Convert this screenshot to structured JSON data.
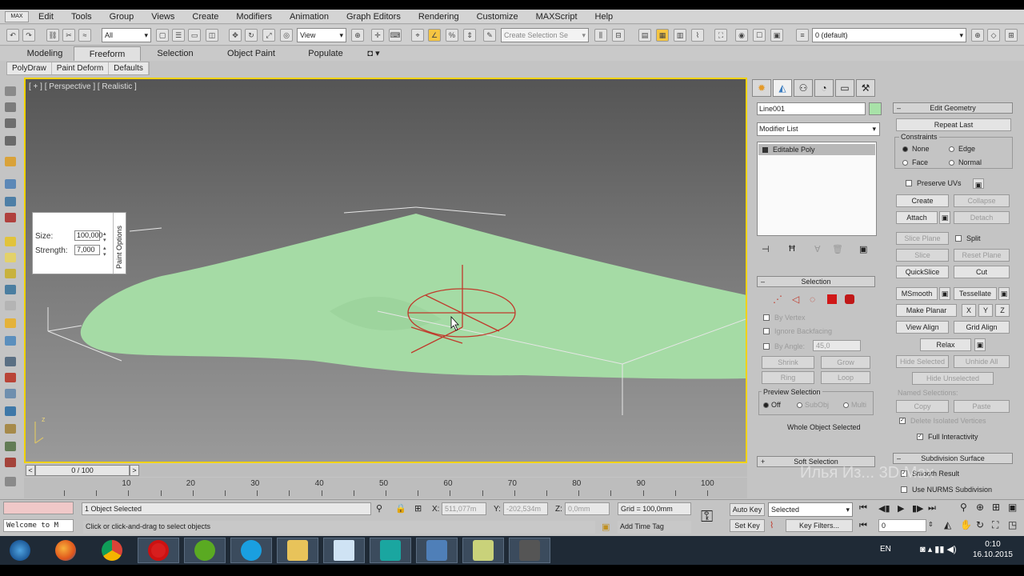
{
  "menu": [
    "Edit",
    "Tools",
    "Group",
    "Views",
    "Create",
    "Modifiers",
    "Animation",
    "Graph Editors",
    "Rendering",
    "Customize",
    "MAXScript",
    "Help"
  ],
  "logo_text": "MAX",
  "toolbar": {
    "filter_select": "All",
    "refcoord_select": "View",
    "selection_set_placeholder": "Create Selection Se",
    "layer_select": "0 (default)"
  },
  "ribbon": {
    "tabs": [
      "Modeling",
      "Freeform",
      "Selection",
      "Object Paint",
      "Populate"
    ],
    "active_tab": "Freeform",
    "sub_items": [
      "PolyDraw",
      "Paint Deform",
      "Defaults"
    ]
  },
  "viewport": {
    "label": "[ + ] [ Perspective ] [ Realistic ]",
    "axis_label": "z",
    "paint_options": {
      "title": "Paint Options",
      "size_label": "Size:",
      "size_value": "100,000",
      "strength_label": "Strength:",
      "strength_value": "7,000"
    }
  },
  "timeline": {
    "frame_display": "0 / 100",
    "prev_label": "<",
    "next_label": ">",
    "ticks": [
      10,
      20,
      30,
      40,
      50,
      60,
      70,
      80,
      90,
      100
    ]
  },
  "command_panel": {
    "object_name": "Line001",
    "modifier_list": "Modifier List",
    "stack_item": "Editable Poly",
    "selection": {
      "header": "Selection",
      "by_vertex": "By Vertex",
      "ignore_backfacing": "Ignore Backfacing",
      "by_angle": "By Angle:",
      "angle_value": "45,0",
      "shrink": "Shrink",
      "grow": "Grow",
      "ring": "Ring",
      "loop": "Loop",
      "preview_group": "Preview Selection",
      "preview_off": "Off",
      "preview_subobj": "SubObj",
      "preview_multi": "Multi",
      "status": "Whole Object Selected"
    },
    "soft_selection_header": "Soft Selection"
  },
  "edit_geometry": {
    "header": "Edit Geometry",
    "repeat_last": "Repeat Last",
    "constraints_group": "Constraints",
    "none": "None",
    "edge": "Edge",
    "face": "Face",
    "normal": "Normal",
    "preserve_uvs": "Preserve UVs",
    "create": "Create",
    "collapse": "Collapse",
    "attach": "Attach",
    "detach": "Detach",
    "slice_plane": "Slice Plane",
    "split": "Split",
    "slice": "Slice",
    "reset_plane": "Reset Plane",
    "quickslice": "QuickSlice",
    "cut": "Cut",
    "msmooth": "MSmooth",
    "tessellate": "Tessellate",
    "make_planar": "Make Planar",
    "x": "X",
    "y": "Y",
    "z": "Z",
    "view_align": "View Align",
    "grid_align": "Grid Align",
    "relax": "Relax",
    "hide_selected": "Hide Selected",
    "unhide_all": "Unhide All",
    "hide_unselected": "Hide Unselected",
    "named_selections": "Named Selections:",
    "copy": "Copy",
    "paste": "Paste",
    "delete_isolated": "Delete Isolated Vertices",
    "full_interactivity": "Full Interactivity",
    "subdivision_header": "Subdivision Surface",
    "smooth_result": "Smooth Result",
    "use_nurms": "Use NURMS Subdivision"
  },
  "status": {
    "script_listener": "Welcome to M",
    "objects_selected": "1 Object Selected",
    "prompt": "Click or click-and-drag to select objects",
    "x_label": "X:",
    "x_value": "511,077m",
    "y_label": "Y:",
    "y_value": "-202,534m",
    "z_label": "Z:",
    "z_value": "0,0mm",
    "grid": "Grid = 100,0mm",
    "add_time_tag": "Add Time Tag",
    "auto_key": "Auto Key",
    "set_key": "Set Key",
    "selected_select": "Selected",
    "key_filters": "Key Filters...",
    "frame_value": "0"
  },
  "watermark": "Илья Из... 3D Max",
  "tray": {
    "lang": "EN",
    "time": "0:10",
    "date": "16.10.2015"
  },
  "colors": {
    "viewport_border": "#f1d200",
    "mesh_fill": "#a5dba5",
    "brush_red": "#c0392b"
  }
}
